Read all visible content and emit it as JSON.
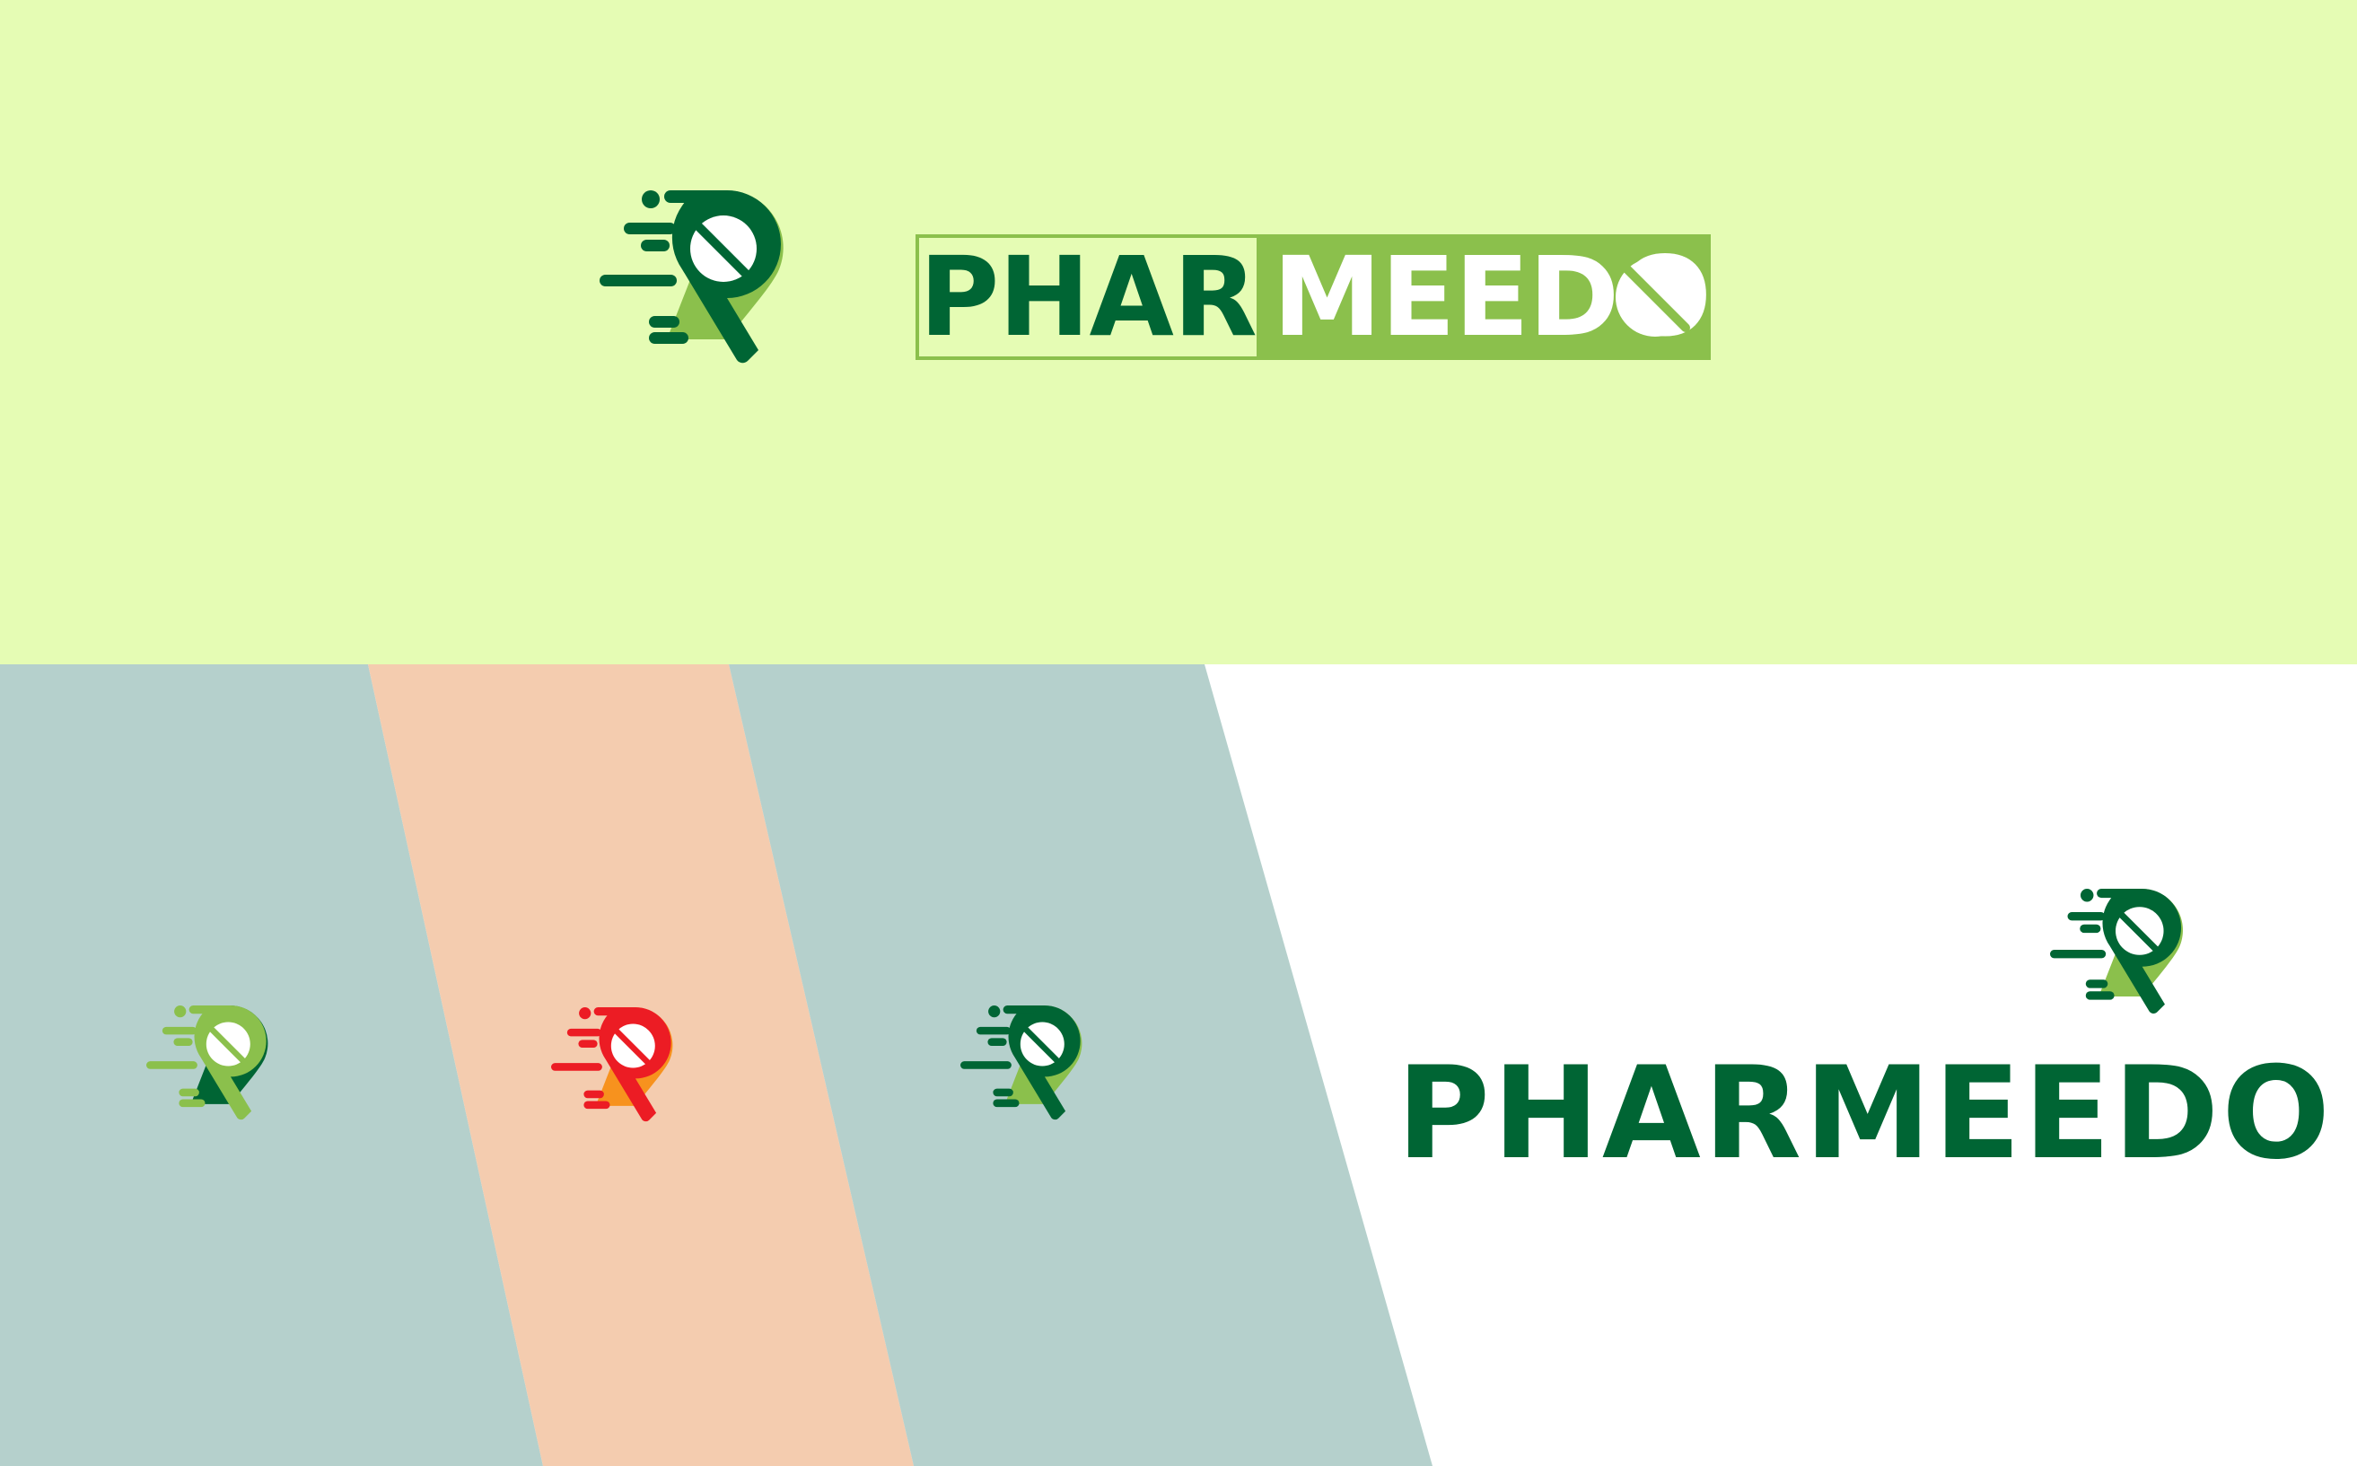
{
  "brand": {
    "name": "PHARMEEDO",
    "wordmark_left": "PHAR",
    "wordmark_right": "MEEDO"
  },
  "colors": {
    "dark_green": "#006534",
    "light_green": "#8bc04c",
    "top_background": "#e5fcb4",
    "slate_band": "#b5d0cc",
    "peach_band": "#f4ccaf",
    "red": "#ec1c24",
    "orange": "#f7921e",
    "white": "#ffffff"
  },
  "icons": {
    "logo": "pharmacy-pin-pill-icon",
    "pill": "pill-icon"
  },
  "variants": [
    {
      "name": "light-green-on-slate",
      "front": "#8bc04c",
      "back": "#006534"
    },
    {
      "name": "red-on-peach",
      "front": "#ec1c24",
      "back": "#f7921e"
    },
    {
      "name": "dark-green-on-slate",
      "front": "#006534",
      "back": "#8bc04c"
    },
    {
      "name": "primary-on-white",
      "front": "#006534",
      "back": "#8bc04c"
    }
  ]
}
